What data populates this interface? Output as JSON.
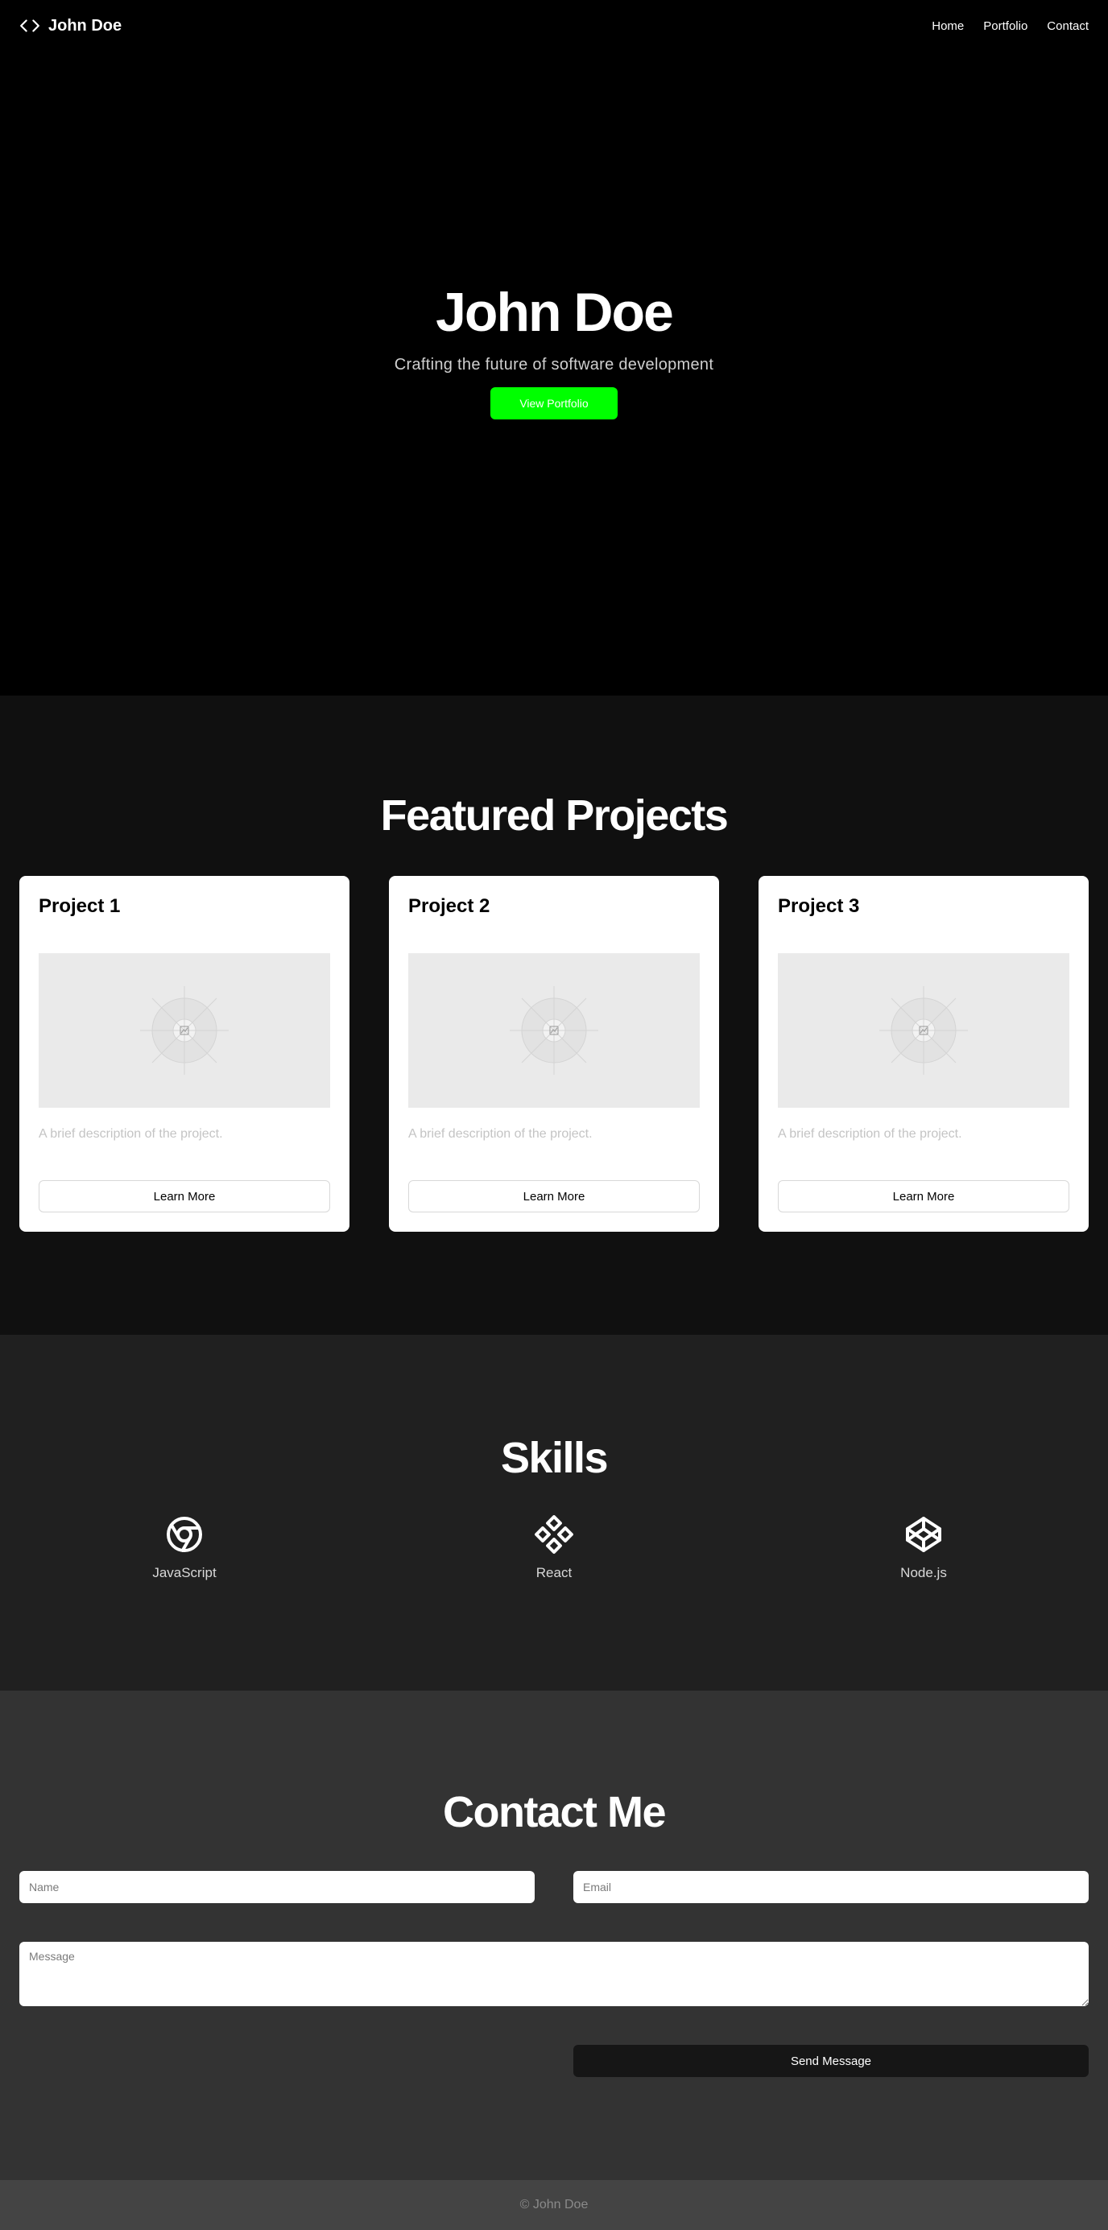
{
  "nav": {
    "brand": "John Doe",
    "brand_icon": "code-icon",
    "links": [
      "Home",
      "Portfolio",
      "Contact"
    ]
  },
  "hero": {
    "title": "John Doe",
    "subtitle": "Crafting the future of software development",
    "button_label": "View Portfolio",
    "button_color": "#00ff00"
  },
  "projects": {
    "title": "Featured Projects",
    "items": [
      {
        "title": "Project 1",
        "description": "A brief description of the project.",
        "button": "Learn More",
        "image_icon": "image-placeholder-icon"
      },
      {
        "title": "Project 2",
        "description": "A brief description of the project.",
        "button": "Learn More",
        "image_icon": "image-placeholder-icon"
      },
      {
        "title": "Project 3",
        "description": "A brief description of the project.",
        "button": "Learn More",
        "image_icon": "image-placeholder-icon"
      }
    ]
  },
  "skills": {
    "title": "Skills",
    "items": [
      {
        "label": "JavaScript",
        "icon": "chrome-icon"
      },
      {
        "label": "React",
        "icon": "figma-components-icon"
      },
      {
        "label": "Node.js",
        "icon": "codepen-icon"
      }
    ]
  },
  "contact": {
    "title": "Contact Me",
    "name_placeholder": "Name",
    "email_placeholder": "Email",
    "message_placeholder": "Message",
    "send_label": "Send Message"
  },
  "footer": {
    "text": "© John Doe"
  },
  "colors": {
    "hero_bg": "#000000",
    "projects_bg": "#101010",
    "skills_bg": "#202020",
    "contact_bg": "#333333",
    "footer_bg": "#444444",
    "accent": "#00ff00"
  }
}
